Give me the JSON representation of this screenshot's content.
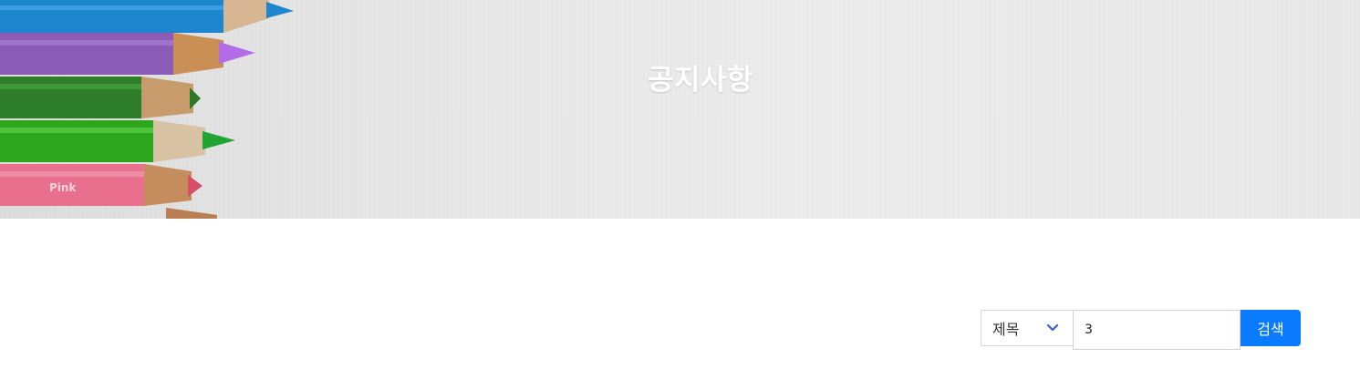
{
  "hero": {
    "title": "공지사항",
    "background_color": "#e6e6e6",
    "illustration": "colored-pencils",
    "pencil_label": "Pink"
  },
  "search": {
    "filter": {
      "selected": "제목",
      "icon": "chevron-down-icon",
      "icon_color": "#3e5bd6"
    },
    "input_value": "3",
    "button_label": "검색",
    "button_color": "#0a7bff"
  }
}
